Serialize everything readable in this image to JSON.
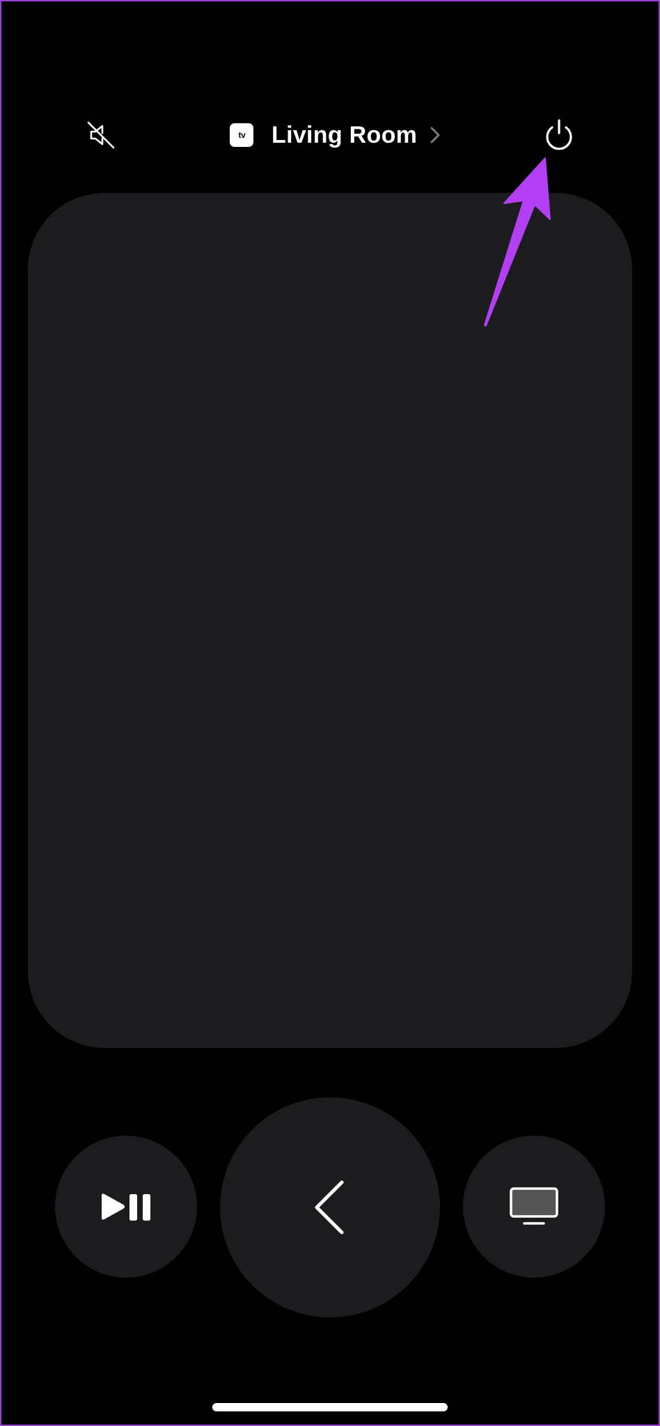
{
  "top_bar": {
    "mute_icon": "speaker-slash-icon",
    "device_badge_text": "tv",
    "device_name": "Living Room",
    "chevron_icon": "chevron-right-icon",
    "power_icon": "power-icon"
  },
  "touch_surface": {
    "color": "#1c1c1e"
  },
  "controls": {
    "play_pause_icon": "play-pause-icon",
    "back_icon": "chevron-left-icon",
    "tv_icon": "tv-icon"
  },
  "annotation": {
    "arrow_color": "#b23ff4"
  }
}
